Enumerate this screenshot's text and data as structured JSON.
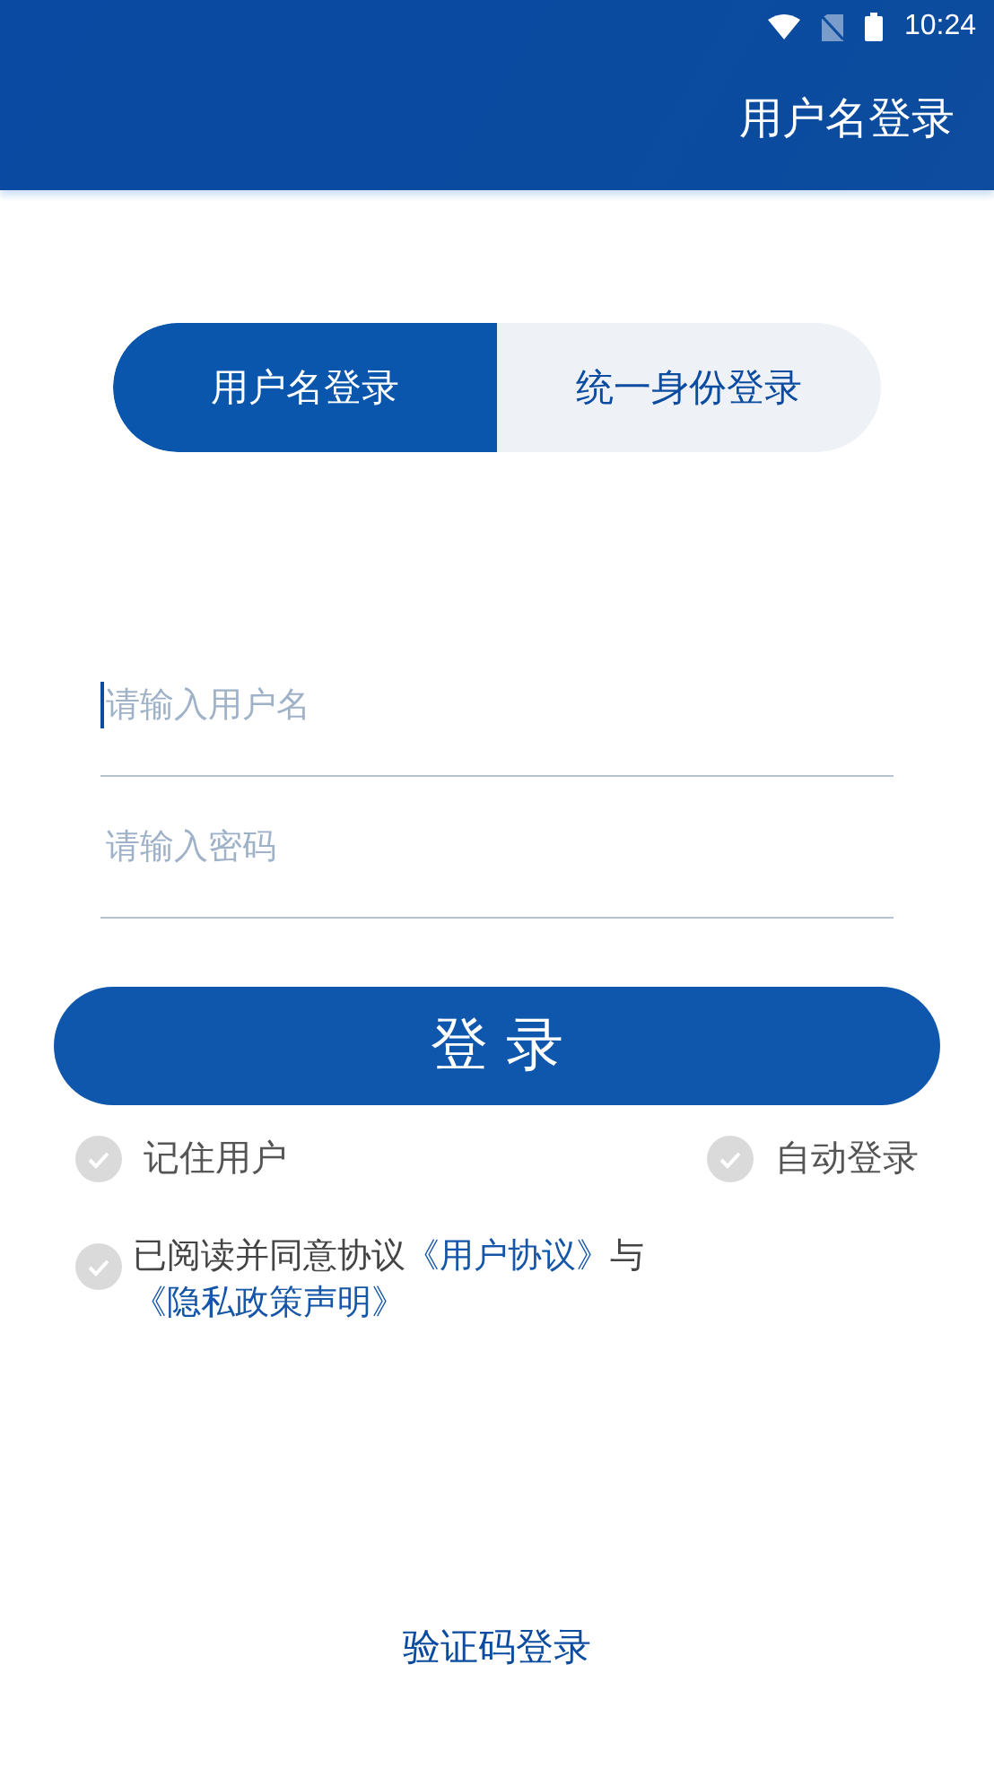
{
  "status_bar": {
    "time": "10:24"
  },
  "header": {
    "title": "用户名登录"
  },
  "tabs": [
    {
      "label": "用户名登录",
      "selected": true
    },
    {
      "label": "统一身份登录",
      "selected": false
    }
  ],
  "fields": [
    {
      "placeholder": "请输入用户名",
      "focused": true
    },
    {
      "placeholder": "请输入密码",
      "focused": false
    }
  ],
  "login_button": {
    "label": "登 录"
  },
  "options": [
    {
      "label": "记住用户",
      "checked": false
    },
    {
      "label": "自动登录",
      "checked": false
    }
  ],
  "agreement": {
    "checked": false,
    "parts": [
      {
        "kind": "text",
        "text": "已阅读并同意协议"
      },
      {
        "kind": "link",
        "text": "《用户协议》"
      },
      {
        "kind": "text",
        "text": "与"
      },
      {
        "kind": "link",
        "text": "《隐私政策声明》"
      }
    ]
  },
  "sms_login": {
    "label": "验证码登录"
  }
}
